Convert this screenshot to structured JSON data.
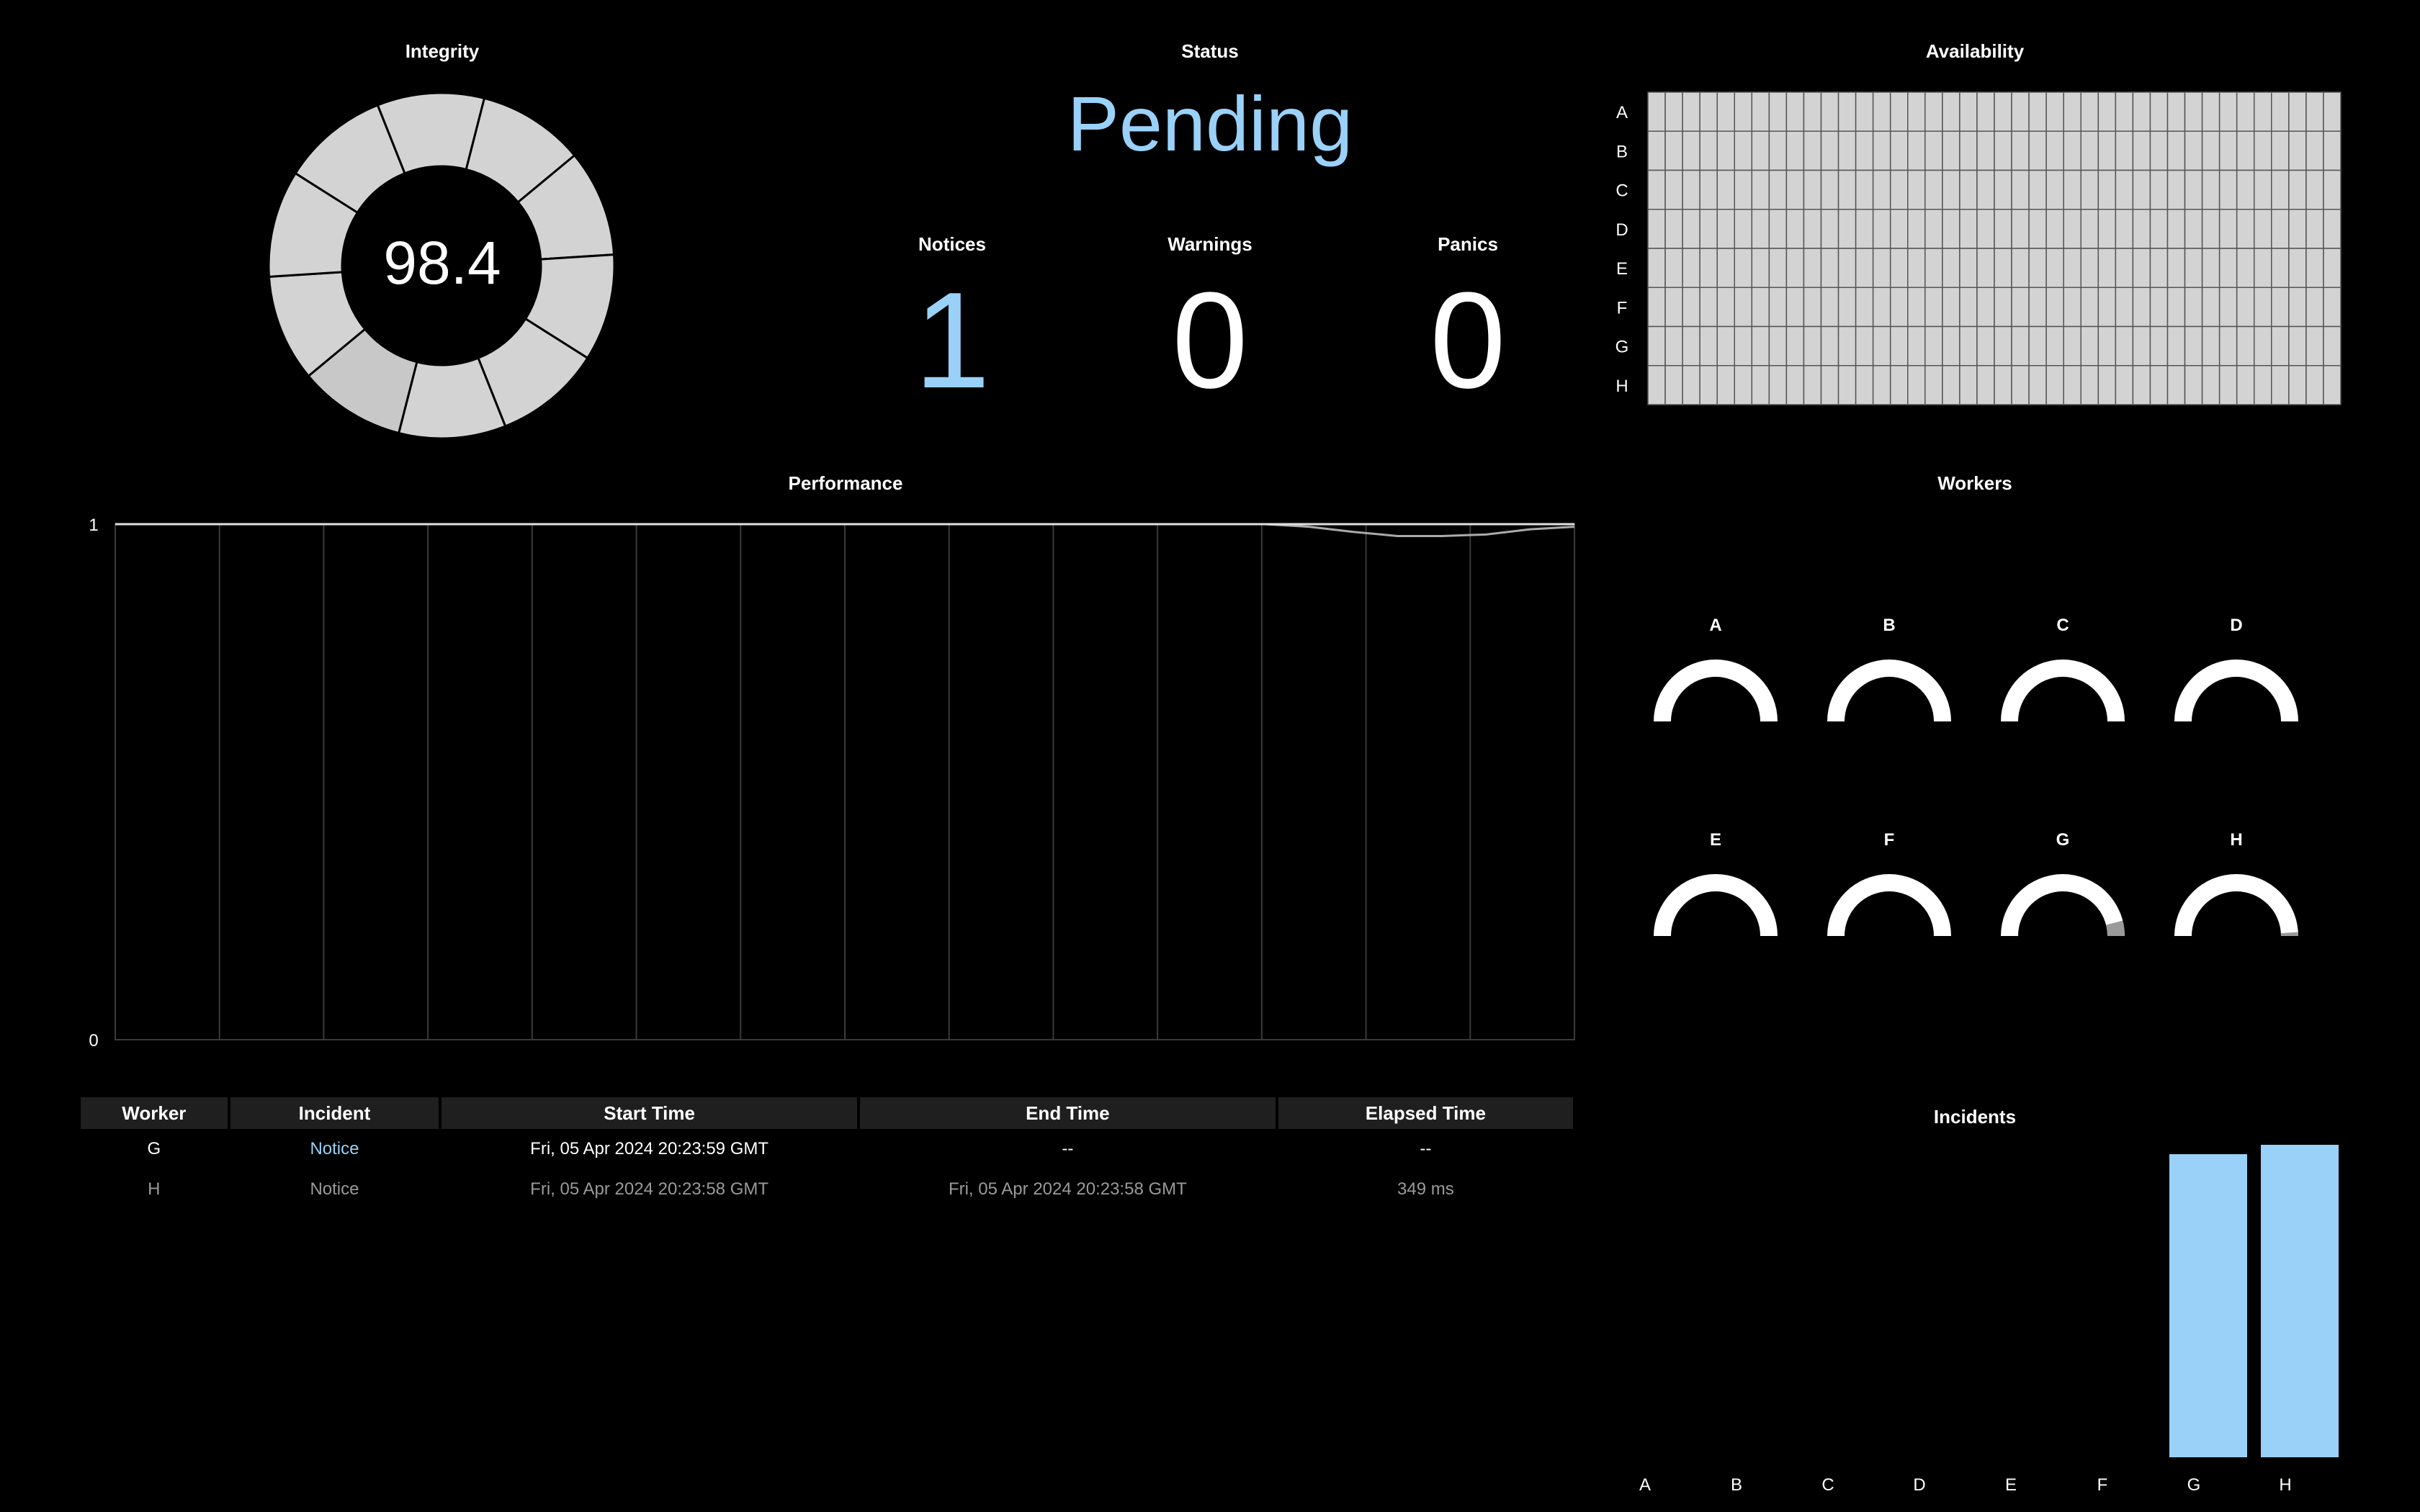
{
  "colors": {
    "accent": "#99d1f9",
    "tile": "#d3d3d3",
    "background": "#000000"
  },
  "integrity": {
    "title": "Integrity",
    "value": "98.4",
    "segments": 10
  },
  "status": {
    "title": "Status",
    "value": "Pending"
  },
  "counters": [
    {
      "label": "Notices",
      "value": "1",
      "color": "#99d1f9"
    },
    {
      "label": "Warnings",
      "value": "0",
      "color": "#ffffff"
    },
    {
      "label": "Panics",
      "value": "0",
      "color": "#ffffff"
    }
  ],
  "availability": {
    "title": "Availability",
    "rows": [
      "A",
      "B",
      "C",
      "D",
      "E",
      "F",
      "G",
      "H"
    ],
    "columns": 40
  },
  "performance": {
    "title": "Performance",
    "chart_data": {
      "type": "line",
      "y_ticks": [
        "1",
        "0"
      ],
      "ylim": [
        0,
        1
      ],
      "grid": "vertical",
      "vertical_gridlines": 14,
      "series": [
        {
          "values": [
            1,
            1,
            1,
            1,
            1,
            1,
            1,
            1,
            1,
            1,
            1,
            1,
            1,
            1,
            1,
            1,
            1,
            1,
            1,
            1,
            1,
            1,
            1,
            1,
            1,
            1,
            1,
            0.995,
            0.985,
            0.977,
            0.977,
            0.98,
            0.99,
            0.995
          ]
        },
        {
          "values": [
            1,
            1,
            1,
            1,
            1,
            1,
            1,
            1,
            1,
            1,
            1,
            1,
            1,
            1,
            1,
            1,
            1,
            1,
            1,
            1,
            1,
            1,
            1,
            1,
            1,
            1,
            1,
            1,
            1,
            1,
            1,
            1,
            1,
            1
          ]
        }
      ]
    }
  },
  "workers": {
    "title": "Workers",
    "items": [
      {
        "label": "A",
        "value": 0
      },
      {
        "label": "B",
        "value": 0
      },
      {
        "label": "C",
        "value": 0
      },
      {
        "label": "D",
        "value": 0
      },
      {
        "label": "E",
        "value": 0
      },
      {
        "label": "F",
        "value": 0
      },
      {
        "label": "G",
        "value": 0.08
      },
      {
        "label": "H",
        "value": 0.02
      }
    ]
  },
  "table": {
    "headers": [
      "Worker",
      "Incident",
      "Start Time",
      "End Time",
      "Elapsed Time"
    ],
    "rows": [
      {
        "worker": "G",
        "incident": "Notice",
        "start": "Fri, 05 Apr 2024 20:23:59 GMT",
        "end": "--",
        "elapsed": "--",
        "state": "active"
      },
      {
        "worker": "H",
        "incident": "Notice",
        "start": "Fri, 05 Apr 2024 20:23:58 GMT",
        "end": "Fri, 05 Apr 2024 20:23:58 GMT",
        "elapsed": "349 ms",
        "state": "done"
      }
    ]
  },
  "incidents": {
    "title": "Incidents",
    "chart_data": {
      "type": "bar",
      "categories": [
        "A",
        "B",
        "C",
        "D",
        "E",
        "F",
        "G",
        "H"
      ],
      "values": [
        0,
        0,
        0,
        0,
        0,
        0,
        0.97,
        1
      ],
      "ylim": [
        0,
        1
      ],
      "bar_color": "#99d1f9"
    }
  }
}
